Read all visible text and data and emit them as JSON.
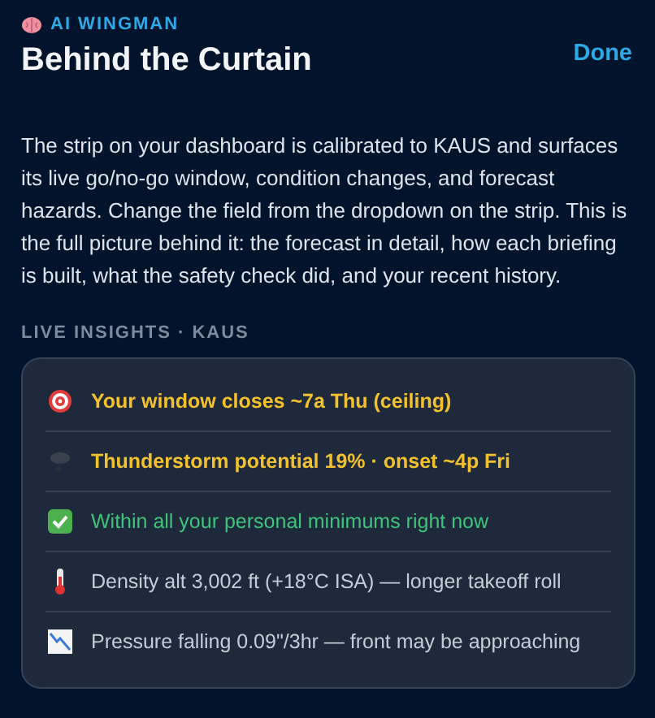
{
  "header": {
    "eyebrow": "AI WINGMAN",
    "title": "Behind the Curtain",
    "done": "Done"
  },
  "intro": "The strip on your dashboard is calibrated to KAUS and surfaces its live go/no-go window, condition changes, and forecast hazards. Change the field from the dropdown on the strip. This is the full picture behind it: the forecast in detail, how each briefing is built, what the safety check did, and your recent history.",
  "section_label": "LIVE INSIGHTS · KAUS",
  "insights": [
    {
      "kind": "warning",
      "text": "Your window closes ~7a Thu (ceiling)"
    },
    {
      "kind": "warning",
      "text": "Thunderstorm potential 19% · onset ~4p Fri"
    },
    {
      "kind": "ok",
      "text": "Within all your personal minimums right now"
    },
    {
      "kind": "info",
      "text": "Density alt 3,002 ft (+18°C ISA) — longer takeoff roll"
    },
    {
      "kind": "info",
      "text": "Pressure falling 0.09\"/3hr — front may be approaching"
    }
  ]
}
